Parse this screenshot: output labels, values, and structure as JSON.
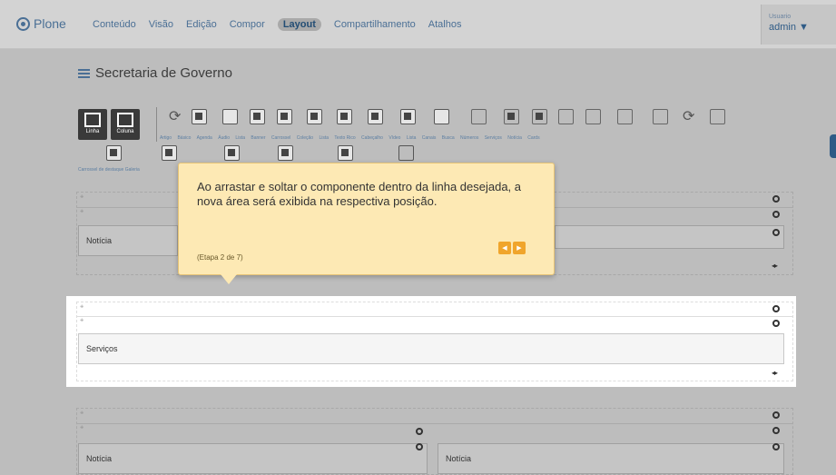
{
  "nav": {
    "logo": "Plone",
    "items": [
      "Conteúdo",
      "Visão",
      "Edição",
      "Compor",
      "Layout",
      "Compartilhamento",
      "Atalhos"
    ],
    "active_index": 4,
    "user_label": "Usuario",
    "user_name": "admin ▼"
  },
  "page": {
    "title": "Secretaria de Governo"
  },
  "toolbar": {
    "layout_buttons": [
      "Linha",
      "Coluna"
    ],
    "tiles": [
      "Artigo",
      "Básico",
      "Agenda",
      "Áudio",
      "Lista",
      "Banner",
      "Carrossel",
      "Coleção",
      "Lista",
      "Texto Rico",
      "Cabeçalho",
      "Vídeo",
      "Lista",
      "Canais",
      "Busca",
      "Números",
      "Serviços",
      "Notícia",
      "Cards"
    ],
    "tiles_row2": [
      "Carrossel de destaque",
      "Galeria"
    ]
  },
  "rows": {
    "top_cell": "Notícia",
    "highlight_cell": "Serviços",
    "bottom_cell_left": "Notícia",
    "bottom_cell_right": "Notícia"
  },
  "tooltip": {
    "text": "Ao arrastar e soltar o componente dentro da linha desejada, a nova área será exibida na respectiva posição.",
    "step": "(Etapa 2 de 7)",
    "prev": "◀",
    "next": "▶"
  },
  "colors": {
    "tooltip_bg": "#fde9b4",
    "tooltip_btn": "#f0a52c",
    "accent": "#4a6f95"
  }
}
